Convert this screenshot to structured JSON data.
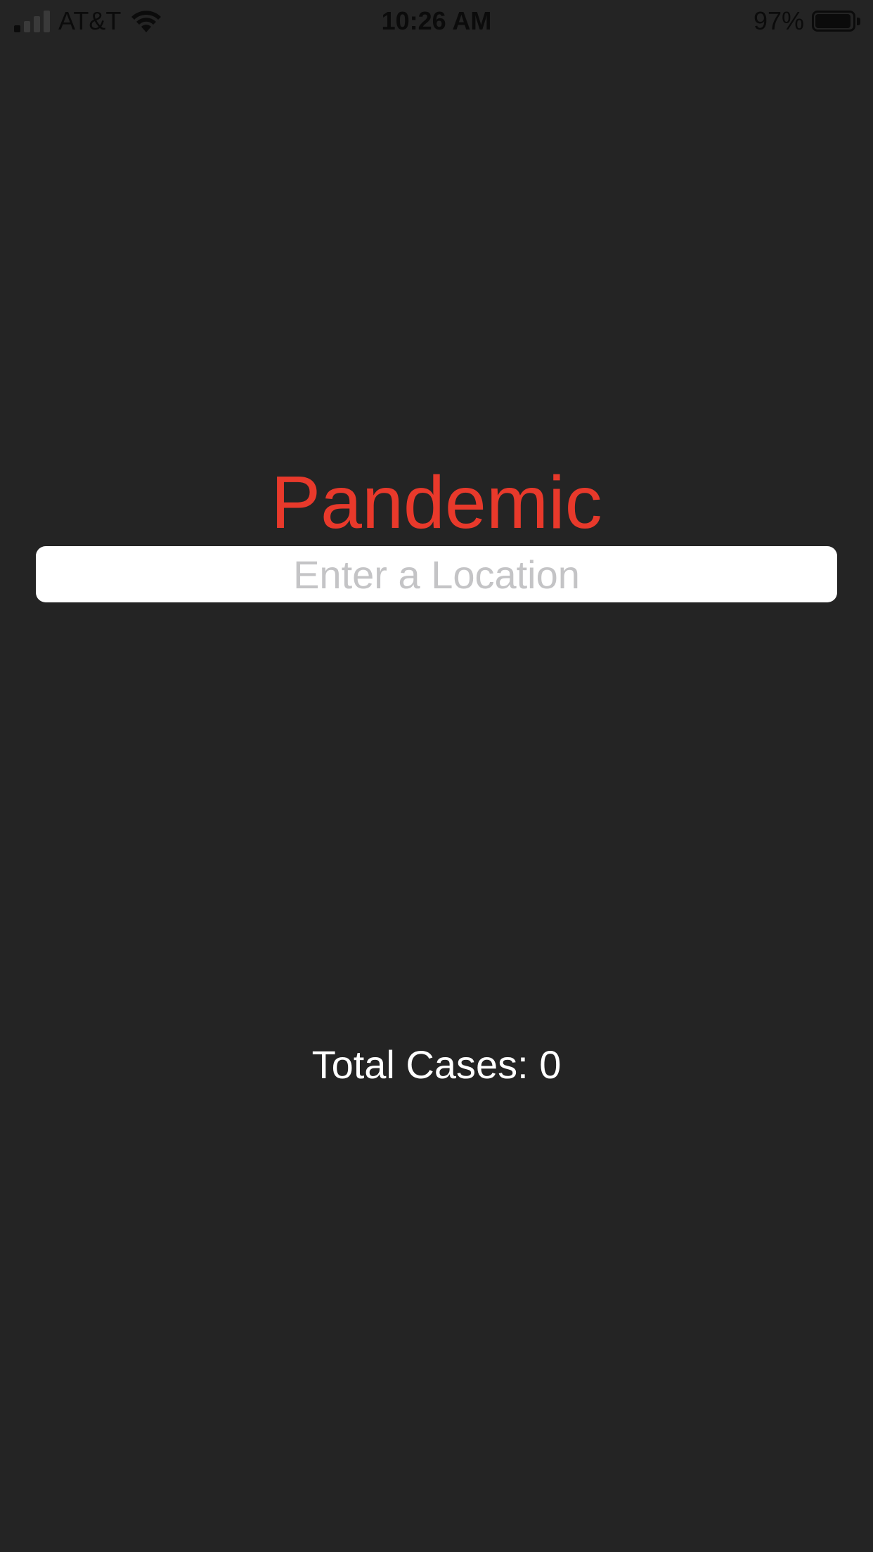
{
  "status_bar": {
    "carrier": "AT&T",
    "time": "10:26 AM",
    "battery_percent": "97%",
    "battery_level": 0.97,
    "signal_bars_active": 1,
    "signal_bars_total": 4,
    "signal_icon": "cellular-signal-icon",
    "wifi_icon": "wifi-icon",
    "battery_icon": "battery-icon"
  },
  "app": {
    "title": "Pandemic",
    "title_color": "#e8392b",
    "background_color": "#242424"
  },
  "search": {
    "placeholder": "Enter a Location",
    "value": ""
  },
  "stats": {
    "total_cases_text": "Total Cases: 0"
  }
}
